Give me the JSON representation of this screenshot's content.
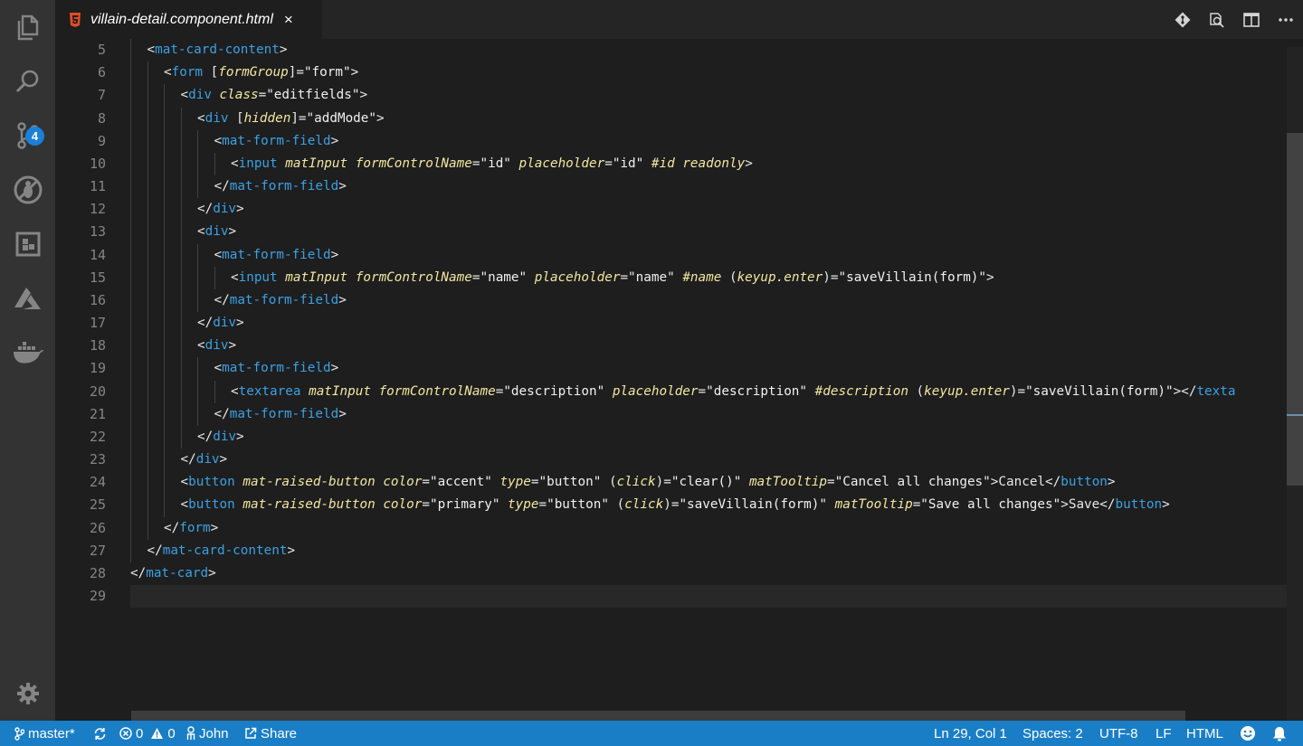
{
  "tab": {
    "filename": "villain-detail.component.html",
    "close_glyph": "×"
  },
  "activity_bar": {
    "items": [
      {
        "icon": "files-icon"
      },
      {
        "icon": "search-icon"
      },
      {
        "icon": "source-control-icon",
        "badge": "4"
      },
      {
        "icon": "debug-icon"
      },
      {
        "icon": "extensions-icon"
      },
      {
        "icon": "azure-icon"
      },
      {
        "icon": "docker-icon"
      }
    ],
    "settings_icon": "gear-icon"
  },
  "editor": {
    "line_numbers": [
      "5",
      "6",
      "7",
      "8",
      "9",
      "10",
      "11",
      "12",
      "13",
      "14",
      "15",
      "16",
      "17",
      "18",
      "19",
      "20",
      "21",
      "22",
      "23",
      "24",
      "25",
      "26",
      "27",
      "28",
      "29"
    ],
    "current_line": "29",
    "lines": [
      {
        "indent": 1,
        "tokens": [
          [
            "p",
            "<"
          ],
          [
            "g",
            "mat-card-content"
          ],
          [
            "p",
            ">"
          ]
        ]
      },
      {
        "indent": 2,
        "tokens": [
          [
            "p",
            "<"
          ],
          [
            "g",
            "form"
          ],
          [
            "t",
            " "
          ],
          [
            "p",
            "["
          ],
          [
            "a",
            "formGroup"
          ],
          [
            "p",
            "]="
          ],
          [
            "s",
            "\"form\""
          ],
          [
            "p",
            ">"
          ]
        ]
      },
      {
        "indent": 3,
        "tokens": [
          [
            "p",
            "<"
          ],
          [
            "g",
            "div"
          ],
          [
            "t",
            " "
          ],
          [
            "a",
            "class"
          ],
          [
            "p",
            "="
          ],
          [
            "s",
            "\"editfields\""
          ],
          [
            "p",
            ">"
          ]
        ]
      },
      {
        "indent": 4,
        "tokens": [
          [
            "p",
            "<"
          ],
          [
            "g",
            "div"
          ],
          [
            "t",
            " "
          ],
          [
            "p",
            "["
          ],
          [
            "a",
            "hidden"
          ],
          [
            "p",
            "]="
          ],
          [
            "s",
            "\"addMode\""
          ],
          [
            "p",
            ">"
          ]
        ]
      },
      {
        "indent": 5,
        "tokens": [
          [
            "p",
            "<"
          ],
          [
            "g",
            "mat-form-field"
          ],
          [
            "p",
            ">"
          ]
        ]
      },
      {
        "indent": 6,
        "tokens": [
          [
            "p",
            "<"
          ],
          [
            "g",
            "input"
          ],
          [
            "t",
            " "
          ],
          [
            "a",
            "matInput"
          ],
          [
            "t",
            " "
          ],
          [
            "a",
            "formControlName"
          ],
          [
            "p",
            "="
          ],
          [
            "s",
            "\"id\""
          ],
          [
            "t",
            " "
          ],
          [
            "a",
            "placeholder"
          ],
          [
            "p",
            "="
          ],
          [
            "s",
            "\"id\""
          ],
          [
            "t",
            " "
          ],
          [
            "a",
            "#id"
          ],
          [
            "t",
            " "
          ],
          [
            "a",
            "readonly"
          ],
          [
            "p",
            ">"
          ]
        ]
      },
      {
        "indent": 5,
        "tokens": [
          [
            "p",
            "</"
          ],
          [
            "g",
            "mat-form-field"
          ],
          [
            "p",
            ">"
          ]
        ]
      },
      {
        "indent": 4,
        "tokens": [
          [
            "p",
            "</"
          ],
          [
            "g",
            "div"
          ],
          [
            "p",
            ">"
          ]
        ]
      },
      {
        "indent": 4,
        "tokens": [
          [
            "p",
            "<"
          ],
          [
            "g",
            "div"
          ],
          [
            "p",
            ">"
          ]
        ]
      },
      {
        "indent": 5,
        "tokens": [
          [
            "p",
            "<"
          ],
          [
            "g",
            "mat-form-field"
          ],
          [
            "p",
            ">"
          ]
        ]
      },
      {
        "indent": 6,
        "tokens": [
          [
            "p",
            "<"
          ],
          [
            "g",
            "input"
          ],
          [
            "t",
            " "
          ],
          [
            "a",
            "matInput"
          ],
          [
            "t",
            " "
          ],
          [
            "a",
            "formControlName"
          ],
          [
            "p",
            "="
          ],
          [
            "s",
            "\"name\""
          ],
          [
            "t",
            " "
          ],
          [
            "a",
            "placeholder"
          ],
          [
            "p",
            "="
          ],
          [
            "s",
            "\"name\""
          ],
          [
            "t",
            " "
          ],
          [
            "a",
            "#name"
          ],
          [
            "t",
            " "
          ],
          [
            "p",
            "("
          ],
          [
            "a",
            "keyup.enter"
          ],
          [
            "p",
            ")="
          ],
          [
            "s",
            "\"saveVillain(form)\""
          ],
          [
            "p",
            ">"
          ]
        ]
      },
      {
        "indent": 5,
        "tokens": [
          [
            "p",
            "</"
          ],
          [
            "g",
            "mat-form-field"
          ],
          [
            "p",
            ">"
          ]
        ]
      },
      {
        "indent": 4,
        "tokens": [
          [
            "p",
            "</"
          ],
          [
            "g",
            "div"
          ],
          [
            "p",
            ">"
          ]
        ]
      },
      {
        "indent": 4,
        "tokens": [
          [
            "p",
            "<"
          ],
          [
            "g",
            "div"
          ],
          [
            "p",
            ">"
          ]
        ]
      },
      {
        "indent": 5,
        "tokens": [
          [
            "p",
            "<"
          ],
          [
            "g",
            "mat-form-field"
          ],
          [
            "p",
            ">"
          ]
        ]
      },
      {
        "indent": 6,
        "tokens": [
          [
            "p",
            "<"
          ],
          [
            "g",
            "textarea"
          ],
          [
            "t",
            " "
          ],
          [
            "a",
            "matInput"
          ],
          [
            "t",
            " "
          ],
          [
            "a",
            "formControlName"
          ],
          [
            "p",
            "="
          ],
          [
            "s",
            "\"description\""
          ],
          [
            "t",
            " "
          ],
          [
            "a",
            "placeholder"
          ],
          [
            "p",
            "="
          ],
          [
            "s",
            "\"description\""
          ],
          [
            "t",
            " "
          ],
          [
            "a",
            "#description"
          ],
          [
            "t",
            " "
          ],
          [
            "p",
            "("
          ],
          [
            "a",
            "keyup.enter"
          ],
          [
            "p",
            ")="
          ],
          [
            "s",
            "\"saveVillain(form)\""
          ],
          [
            "p",
            "></"
          ],
          [
            "g",
            "texta"
          ]
        ]
      },
      {
        "indent": 5,
        "tokens": [
          [
            "p",
            "</"
          ],
          [
            "g",
            "mat-form-field"
          ],
          [
            "p",
            ">"
          ]
        ]
      },
      {
        "indent": 4,
        "tokens": [
          [
            "p",
            "</"
          ],
          [
            "g",
            "div"
          ],
          [
            "p",
            ">"
          ]
        ]
      },
      {
        "indent": 3,
        "tokens": [
          [
            "p",
            "</"
          ],
          [
            "g",
            "div"
          ],
          [
            "p",
            ">"
          ]
        ]
      },
      {
        "indent": 3,
        "tokens": [
          [
            "p",
            "<"
          ],
          [
            "g",
            "button"
          ],
          [
            "t",
            " "
          ],
          [
            "a",
            "mat-raised-button"
          ],
          [
            "t",
            " "
          ],
          [
            "a",
            "color"
          ],
          [
            "p",
            "="
          ],
          [
            "s",
            "\"accent\""
          ],
          [
            "t",
            " "
          ],
          [
            "a",
            "type"
          ],
          [
            "p",
            "="
          ],
          [
            "s",
            "\"button\""
          ],
          [
            "t",
            " "
          ],
          [
            "p",
            "("
          ],
          [
            "a",
            "click"
          ],
          [
            "p",
            ")="
          ],
          [
            "s",
            "\"clear()\""
          ],
          [
            "t",
            " "
          ],
          [
            "a",
            "matTooltip"
          ],
          [
            "p",
            "="
          ],
          [
            "s",
            "\"Cancel all changes\""
          ],
          [
            "p",
            ">"
          ],
          [
            "x",
            "Cancel"
          ],
          [
            "p",
            "</"
          ],
          [
            "g",
            "button"
          ],
          [
            "p",
            ">"
          ]
        ]
      },
      {
        "indent": 3,
        "tokens": [
          [
            "p",
            "<"
          ],
          [
            "g",
            "button"
          ],
          [
            "t",
            " "
          ],
          [
            "a",
            "mat-raised-button"
          ],
          [
            "t",
            " "
          ],
          [
            "a",
            "color"
          ],
          [
            "p",
            "="
          ],
          [
            "s",
            "\"primary\""
          ],
          [
            "t",
            " "
          ],
          [
            "a",
            "type"
          ],
          [
            "p",
            "="
          ],
          [
            "s",
            "\"button\""
          ],
          [
            "t",
            " "
          ],
          [
            "p",
            "("
          ],
          [
            "a",
            "click"
          ],
          [
            "p",
            ")="
          ],
          [
            "s",
            "\"saveVillain(form)\""
          ],
          [
            "t",
            " "
          ],
          [
            "a",
            "matTooltip"
          ],
          [
            "p",
            "="
          ],
          [
            "s",
            "\"Save all changes\""
          ],
          [
            "p",
            ">"
          ],
          [
            "x",
            "Save"
          ],
          [
            "p",
            "</"
          ],
          [
            "g",
            "button"
          ],
          [
            "p",
            ">"
          ]
        ]
      },
      {
        "indent": 2,
        "tokens": [
          [
            "p",
            "</"
          ],
          [
            "g",
            "form"
          ],
          [
            "p",
            ">"
          ]
        ]
      },
      {
        "indent": 1,
        "tokens": [
          [
            "p",
            "</"
          ],
          [
            "g",
            "mat-card-content"
          ],
          [
            "p",
            ">"
          ]
        ]
      },
      {
        "indent": 0,
        "tokens": [
          [
            "p",
            "</"
          ],
          [
            "g",
            "mat-card"
          ],
          [
            "p",
            ">"
          ]
        ]
      },
      {
        "indent": 0,
        "tokens": []
      }
    ]
  },
  "status_bar": {
    "branch": "master*",
    "errors": "0",
    "warnings": "0",
    "user": "John",
    "share": "Share",
    "position": "Ln 29, Col 1",
    "spaces": "Spaces: 2",
    "encoding": "UTF-8",
    "eol": "LF",
    "language": "HTML"
  },
  "colors": {
    "tag": "#3ba1e4",
    "attribute": "#f2e6a0",
    "status_bar": "#1a7ec7",
    "badge": "#1b80d8"
  }
}
